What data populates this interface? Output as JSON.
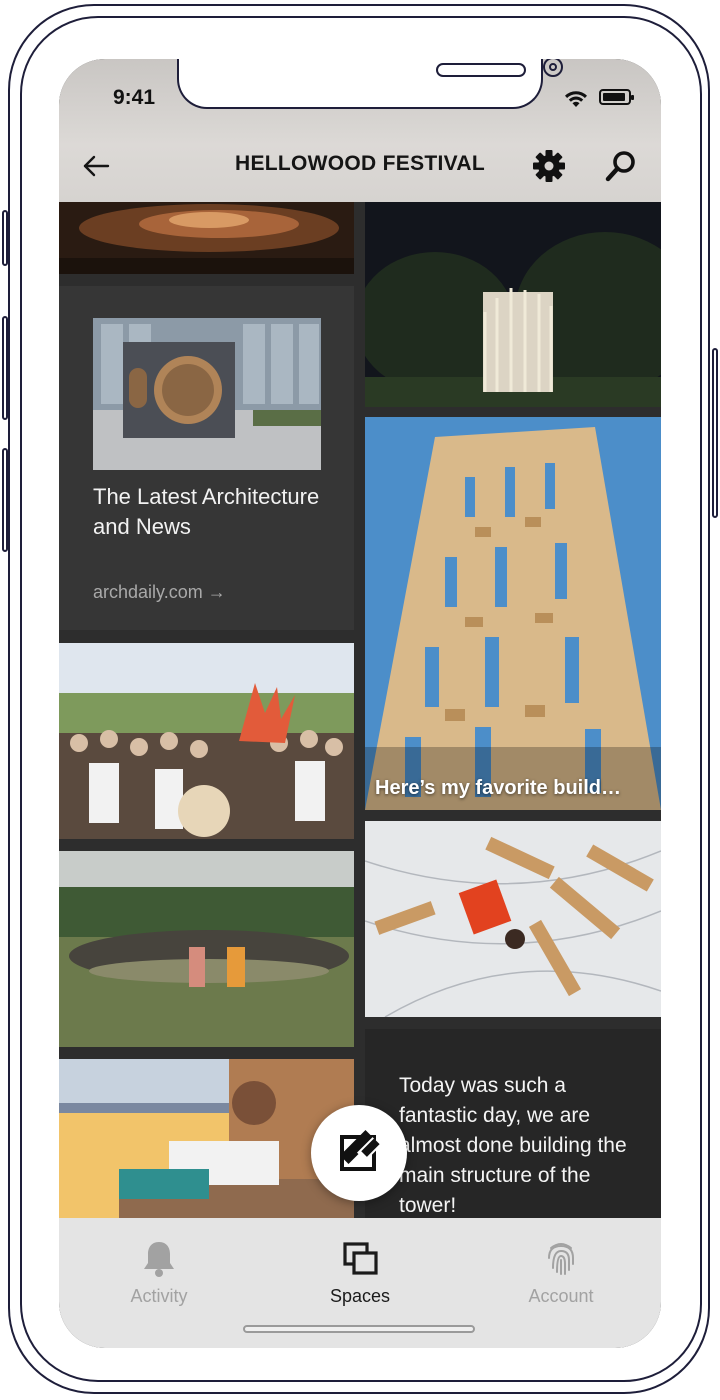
{
  "status_bar": {
    "time": "9:41"
  },
  "header": {
    "title": "HELLOWOOD FESTIVAL"
  },
  "icons": {
    "back": "arrow-left-icon",
    "settings": "gear-icon",
    "search": "search-icon",
    "compose": "edit-icon"
  },
  "feed": {
    "link_card": {
      "title": "The Latest Architecture and News",
      "domain": "archdaily.com →"
    },
    "photo_caption": "Here’s my favorite build…",
    "text_post": "Today was such a fantastic day, we are almost done building the main structure of the tower!"
  },
  "tabs": [
    {
      "label": "Activity",
      "icon": "bell-icon",
      "active": false
    },
    {
      "label": "Spaces",
      "icon": "spaces-icon",
      "active": true
    },
    {
      "label": "Account",
      "icon": "fingerprint-icon",
      "active": false
    }
  ],
  "colors": {
    "header_bg": "#d6d3d0",
    "feed_bg": "#2d2d2d",
    "tabbar_bg": "#e4e4e4",
    "active_tab": "#1b1b1b",
    "inactive_tab": "#a2a2a2"
  }
}
